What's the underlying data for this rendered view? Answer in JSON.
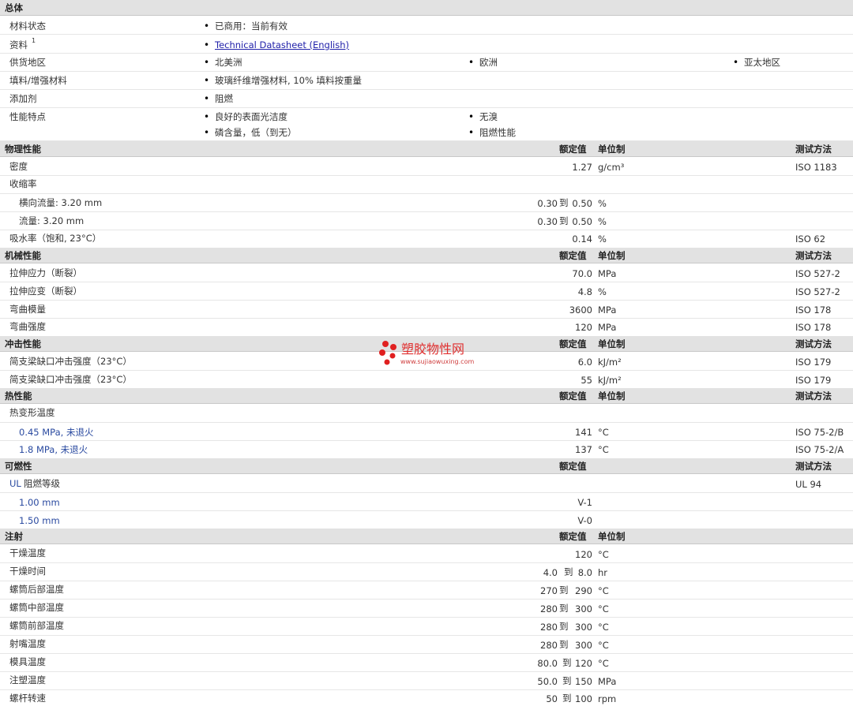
{
  "general": {
    "title": "总体",
    "material_status_label": "材料状态",
    "material_status_value": "已商用：当前有效",
    "docs_label": "资料",
    "docs_sup": "1",
    "docs_link": "Technical Datasheet (English)",
    "region_label": "供货地区",
    "regions": [
      "北美洲",
      "欧洲",
      "亚太地区"
    ],
    "filler_label": "填料/增强材料",
    "filler_value": "玻璃纤维增强材料, 10% 填料按重量",
    "additive_label": "添加剂",
    "additive_value": "阻燃",
    "features_label": "性能特点",
    "features": [
      "良好的表面光洁度",
      "无溴",
      "磷含量，低（到无）",
      "阻燃性能"
    ]
  },
  "headers": {
    "nominal": "额定值",
    "unit": "单位制",
    "method": "测试方法"
  },
  "physical": {
    "title": "物理性能",
    "rows": [
      {
        "label": "密度",
        "value": "1.27",
        "unit": "g/cm³",
        "method": "ISO 1183"
      },
      {
        "label": "收缩率"
      },
      {
        "label": "横向流量: 3.20 mm",
        "v1": "0.30",
        "to": "到",
        "v2": "0.50",
        "unit": "%"
      },
      {
        "label": "流量: 3.20 mm",
        "v1": "0.30",
        "to": "到",
        "v2": "0.50",
        "unit": "%"
      },
      {
        "label": "吸水率（饱和, 23°C）",
        "value": "0.14",
        "unit": "%",
        "method": "ISO 62"
      }
    ]
  },
  "mechanical": {
    "title": "机械性能",
    "rows": [
      {
        "label": "拉伸应力（断裂）",
        "value": "70.0",
        "unit": "MPa",
        "method": "ISO 527-2"
      },
      {
        "label": "拉伸应变（断裂）",
        "value": "4.8",
        "unit": "%",
        "method": "ISO 527-2"
      },
      {
        "label": "弯曲模量",
        "value": "3600",
        "unit": "MPa",
        "method": "ISO 178"
      },
      {
        "label": "弯曲强度",
        "value": "120",
        "unit": "MPa",
        "method": "ISO 178"
      }
    ]
  },
  "impact": {
    "title": "冲击性能",
    "rows": [
      {
        "label": "简支梁缺口冲击强度（23°C）",
        "value": "6.0",
        "unit": "kJ/m²",
        "method": "ISO 179"
      },
      {
        "label": "简支梁缺口冲击强度（23°C）",
        "value": "55",
        "unit": "kJ/m²",
        "method": "ISO 179"
      }
    ]
  },
  "thermal": {
    "title": "热性能",
    "rows": [
      {
        "label": "热变形温度"
      },
      {
        "label": "0.45 MPa, 未退火",
        "value": "141",
        "unit": "°C",
        "method": "ISO 75-2/B"
      },
      {
        "label": "1.8 MPa, 未退火",
        "value": "137",
        "unit": "°C",
        "method": "ISO 75-2/A"
      }
    ]
  },
  "flammability": {
    "title": "可燃性",
    "ul_prefix": "UL",
    "ul_label": "阻燃等级",
    "ul_method": "UL 94",
    "rows": [
      {
        "label": "1.00 mm",
        "value": "V-1"
      },
      {
        "label": "1.50 mm",
        "value": "V-0"
      }
    ]
  },
  "injection": {
    "title": "注射",
    "rows": [
      {
        "label": "干燥温度",
        "value": "120",
        "unit": "°C"
      },
      {
        "label": "干燥时间",
        "v1": "4.0",
        "to": "到",
        "v2": "8.0",
        "unit": "hr"
      },
      {
        "label": "螺筒后部温度",
        "v1": "270",
        "to": "到",
        "v2": "290",
        "unit": "°C"
      },
      {
        "label": "螺筒中部温度",
        "v1": "280",
        "to": "到",
        "v2": "300",
        "unit": "°C"
      },
      {
        "label": "螺筒前部温度",
        "v1": "280",
        "to": "到",
        "v2": "300",
        "unit": "°C"
      },
      {
        "label": "射嘴温度",
        "v1": "280",
        "to": "到",
        "v2": "300",
        "unit": "°C"
      },
      {
        "label": "模具温度",
        "v1": "80.0",
        "to": "到",
        "v2": "120",
        "unit": "°C"
      },
      {
        "label": "注塑温度",
        "v1": "50.0",
        "to": "到",
        "v2": "150",
        "unit": "MPa"
      },
      {
        "label": "螺杆转速",
        "v1": "50",
        "to": "到",
        "v2": "100",
        "unit": "rpm"
      }
    ]
  },
  "watermark": {
    "name": "塑胶物性网",
    "url": "www.sujiaowuxing.com"
  }
}
